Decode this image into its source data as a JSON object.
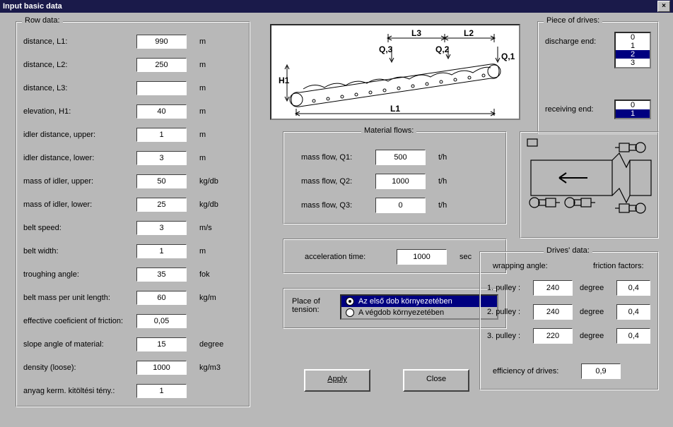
{
  "window": {
    "title": "Input basic data"
  },
  "rowdata": {
    "legend": "Row data:",
    "items": [
      {
        "label": "distance, L1:",
        "value": "990",
        "unit": "m"
      },
      {
        "label": "distance, L2:",
        "value": "250",
        "unit": "m"
      },
      {
        "label": "distance, L3:",
        "value": "",
        "unit": "m"
      },
      {
        "label": "elevation, H1:",
        "value": "40",
        "unit": "m"
      },
      {
        "label": "idler distance, upper:",
        "value": "1",
        "unit": "m"
      },
      {
        "label": "idler distance, lower:",
        "value": "3",
        "unit": "m"
      },
      {
        "label": "mass of idler, upper:",
        "value": "50",
        "unit": "kg/db"
      },
      {
        "label": "mass of idler, lower:",
        "value": "25",
        "unit": "kg/db"
      },
      {
        "label": "belt speed:",
        "value": "3",
        "unit": "m/s"
      },
      {
        "label": "belt width:",
        "value": "1",
        "unit": "m"
      },
      {
        "label": "troughing angle:",
        "value": "35",
        "unit": "fok"
      },
      {
        "label": "belt mass per unit length:",
        "value": "60",
        "unit": "kg/m"
      },
      {
        "label": "effective coeficient of friction:",
        "value": "0,05",
        "unit": ""
      },
      {
        "label": "slope angle of material:",
        "value": "15",
        "unit": "degree"
      },
      {
        "label": "density (loose):",
        "value": "1000",
        "unit": "kg/m3"
      },
      {
        "label": "anyag kerm. kitöltési tény.:",
        "value": "1",
        "unit": ""
      }
    ]
  },
  "diagram_labels": {
    "Q1": "Q,1",
    "Q2": "Q,2",
    "Q3": "Q,3",
    "L1": "L1",
    "L2": "L2",
    "L3": "L3",
    "H1": "H1"
  },
  "flows": {
    "legend": "Material flows:",
    "items": [
      {
        "label": "mass flow, Q1:",
        "value": "500",
        "unit": "t/h"
      },
      {
        "label": "mass flow, Q2:",
        "value": "1000",
        "unit": "t/h"
      },
      {
        "label": "mass flow, Q3:",
        "value": "0",
        "unit": "t/h"
      }
    ]
  },
  "accel": {
    "label": "acceleration  time:",
    "value": "1000",
    "unit": "sec"
  },
  "tension": {
    "label": "Place of tension:",
    "options": [
      {
        "text": "Az első dob környezetében",
        "selected": true
      },
      {
        "text": "A végdob környezetében",
        "selected": false
      }
    ]
  },
  "buttons": {
    "apply": "Apply",
    "close": "Close"
  },
  "pieces": {
    "legend": "Piece of drives:",
    "discharge_label": "discharge end:",
    "discharge_options": [
      "0",
      "1",
      "2",
      "3"
    ],
    "discharge_selected": "2",
    "receiving_label": "receiving end:",
    "receiving_options": [
      "0",
      "1"
    ],
    "receiving_selected": "1"
  },
  "drives": {
    "legend": "Drives' data:",
    "wrap_header": "wrapping angle:",
    "friction_header": "friction factors:",
    "rows": [
      {
        "label": "1. pulley :",
        "angle": "240",
        "unit": "degree",
        "friction": "0,4"
      },
      {
        "label": "2. pulley :",
        "angle": "240",
        "unit": "degree",
        "friction": "0,4"
      },
      {
        "label": "3. pulley :",
        "angle": "220",
        "unit": "degree",
        "friction": "0,4"
      }
    ],
    "eff_label": "efficiency of drives:",
    "eff_value": "0,9"
  }
}
